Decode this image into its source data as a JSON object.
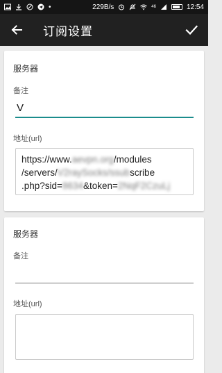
{
  "status_bar": {
    "speed": "229B/s",
    "signal": "46",
    "time": "12:54"
  },
  "appbar": {
    "title": "订阅设置",
    "back_icon": "arrow-left-icon",
    "save_icon": "check-icon"
  },
  "servers": [
    {
      "section_title": "服务器",
      "remark_label": "备注",
      "remark_value": "V",
      "url_label": "地址(url)",
      "url_parts": {
        "p1": "https://www.",
        "host": "aevpn.org",
        "p2": "/modules",
        "p3": "/servers/",
        "path": "V2raySocks/ssub",
        "p4": "scribe",
        "p5": ".php?sid=",
        "sid": "8634",
        "p6": "&token=",
        "token": "2NqF2CzuLj"
      }
    },
    {
      "section_title": "服务器",
      "remark_label": "备注",
      "remark_value": "",
      "url_label": "地址(url)",
      "url_value": ""
    }
  ]
}
